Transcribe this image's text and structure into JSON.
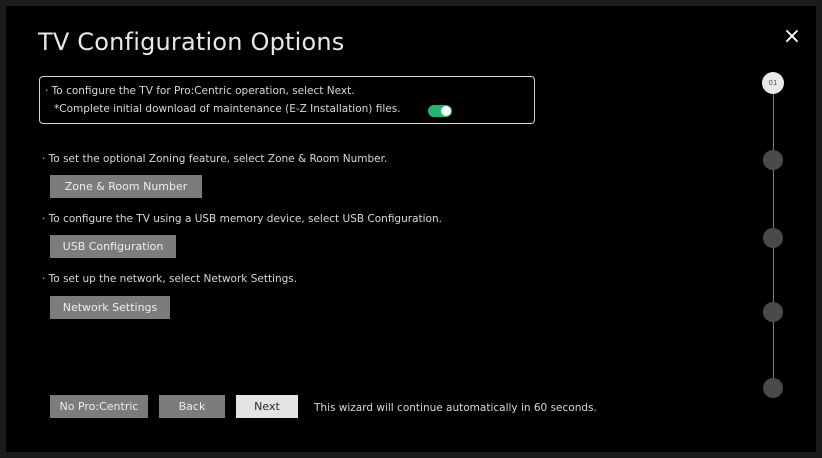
{
  "title": "TV Configuration Options",
  "close_label": "×",
  "intro": {
    "line1": "· To configure the TV for Pro:Centric operation, select Next.",
    "line2": "*Complete initial download of maintenance (E-Z Installation) files.",
    "toggle_on": true
  },
  "sections": {
    "zoning": {
      "text": "· To set the optional Zoning feature, select Zone & Room Number.",
      "button": "Zone & Room Number"
    },
    "usb": {
      "text": "· To configure the TV using a USB memory device, select USB Configuration.",
      "button": "USB Configuration"
    },
    "network": {
      "text": "· To set up the network, select Network Settings.",
      "button": "Network Settings"
    }
  },
  "footer": {
    "no_procentric": "No Pro:Centric",
    "back": "Back",
    "next": "Next",
    "status": "This wizard will continue automatically in 60 seconds."
  },
  "stepper": {
    "current_label": "01",
    "total_steps": 5,
    "current_step": 1
  },
  "colors": {
    "toggle_on": "#1fb873",
    "button_bg": "#7c7c7c",
    "next_bg": "#e4e4e4"
  }
}
